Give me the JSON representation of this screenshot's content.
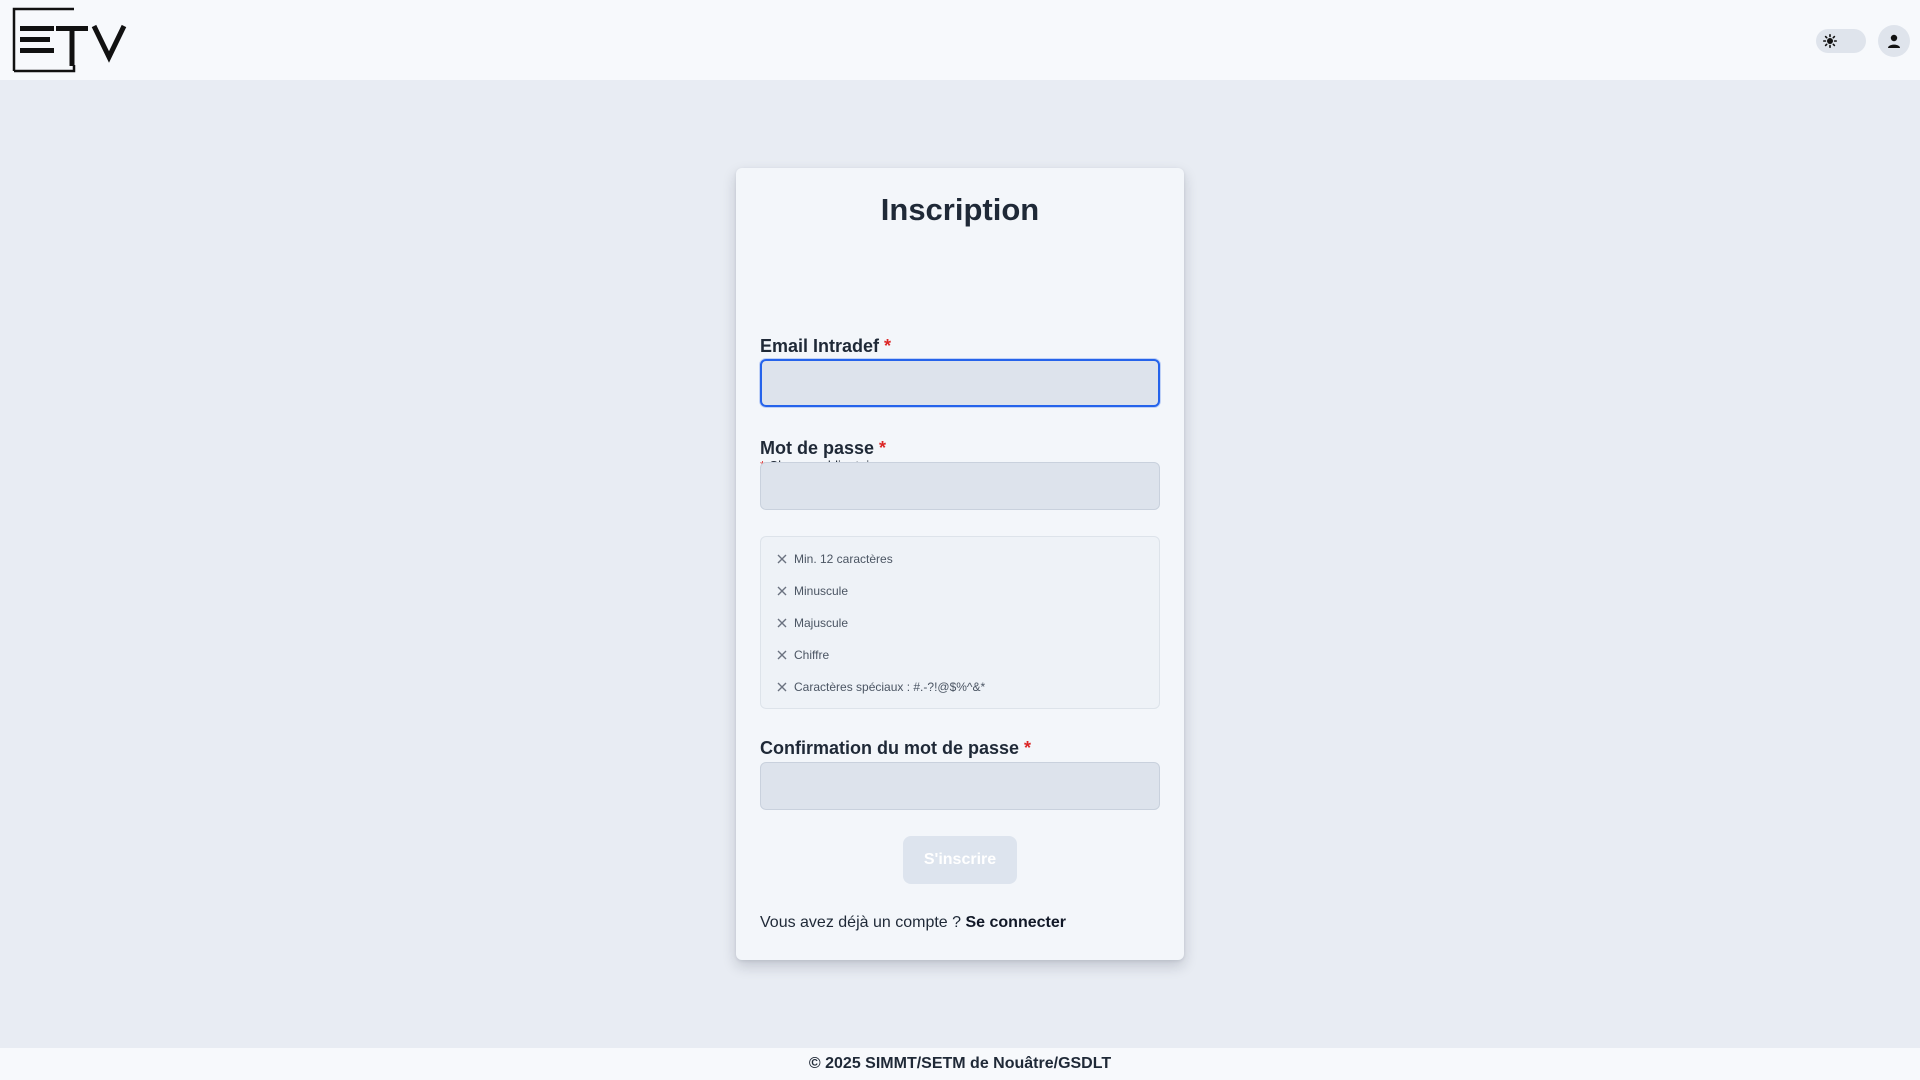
{
  "header": {
    "logo_text": "ETV",
    "theme_toggle_icon": "sun-icon",
    "account_icon": "user-icon"
  },
  "form": {
    "title": "Inscription",
    "required_star": "*",
    "required_note": "Champs obligatoires",
    "email": {
      "label": "Email Intradef",
      "value": "",
      "focused": true
    },
    "password": {
      "label": "Mot de passe",
      "value": ""
    },
    "password_rules": [
      {
        "label": "Min. 12 caractères",
        "met": false
      },
      {
        "label": "Minuscule",
        "met": false
      },
      {
        "label": "Majuscule",
        "met": false
      },
      {
        "label": "Chiffre",
        "met": false
      },
      {
        "label": "Caractères spéciaux : #.-?!@$%^&*",
        "met": false
      }
    ],
    "confirm": {
      "label": "Confirmation du mot de passe",
      "value": ""
    },
    "submit_label": "S'inscrire",
    "login_prompt": "Vous avez déjà un compte ?",
    "login_link": "Se connecter"
  },
  "footer": {
    "text": "© 2025 SIMMT/SETM de Nouâtre/GSDLT"
  },
  "colors": {
    "accent": "#2563eb",
    "required": "#dc2626",
    "page_bg": "#e8ecf3",
    "card_bg": "#f3f6fa"
  }
}
